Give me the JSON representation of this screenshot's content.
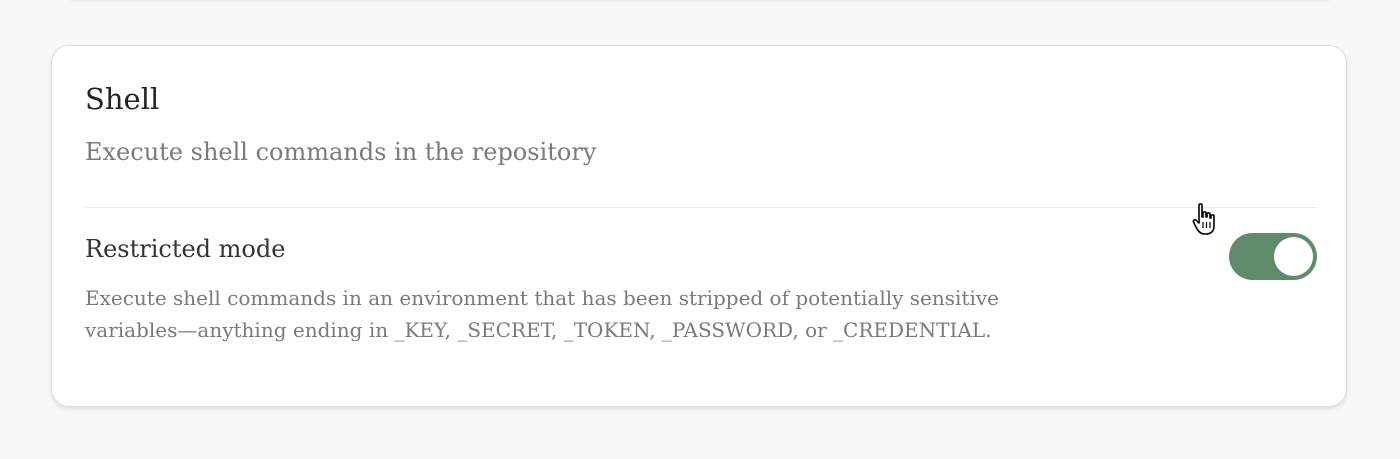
{
  "tool": {
    "title": "Shell",
    "description": "Execute shell commands in the repository"
  },
  "setting": {
    "label": "Restricted mode",
    "description": "Execute shell commands in an environment that has been stripped of potentially sensitive variables—anything ending in _KEY, _SECRET, _TOKEN, _PASSWORD, or _CREDENTIAL.",
    "enabled": true
  },
  "colors": {
    "toggle_on": "#608b6b",
    "background": "#f8f8f7",
    "card": "#ffffff"
  },
  "icons": {
    "cursor": "hand-pointer-icon"
  }
}
